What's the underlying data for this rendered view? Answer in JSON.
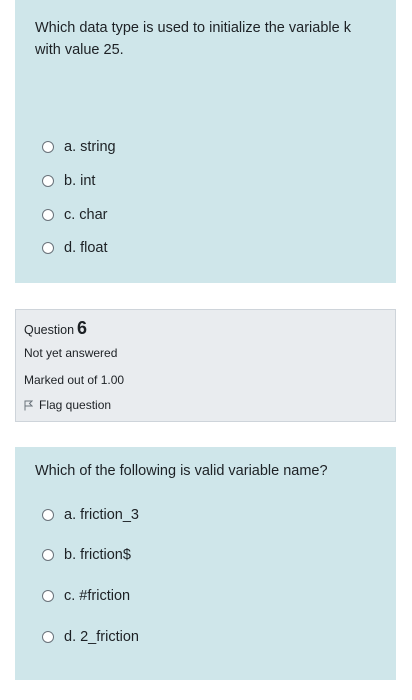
{
  "question5": {
    "text": "Which data type is used to initialize the variable k with value 25.",
    "options": [
      "a. string",
      "b. int",
      "c. char",
      "d. float"
    ]
  },
  "info": {
    "question_label": "Question",
    "question_number": "6",
    "state": "Not yet answered",
    "grade": "Marked out of 1.00",
    "flag_label": "Flag question",
    "flag_icon": "flag-outline-icon"
  },
  "question6": {
    "text": "Which of the following is valid variable name?",
    "options": [
      "a. friction_3",
      "b. friction$",
      "c. #friction",
      "d. 2_friction"
    ]
  },
  "colors": {
    "question_bg": "#cfe6ea",
    "info_bg": "#e9ecef",
    "text": "#1d2125"
  }
}
